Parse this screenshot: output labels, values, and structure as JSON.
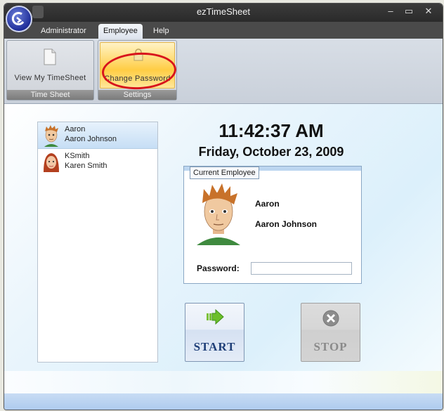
{
  "window": {
    "title": "ezTimeSheet",
    "controls": {
      "minimize": "–",
      "maximize": "▭",
      "close": "✕"
    }
  },
  "menu": {
    "tabs": [
      {
        "label": "Administrator",
        "active": false
      },
      {
        "label": "Employee",
        "active": true
      },
      {
        "label": "Help",
        "active": false
      }
    ]
  },
  "ribbon": {
    "groups": [
      {
        "label": "Time Sheet",
        "button": {
          "label": "View My TimeSheet",
          "icon": "document-icon"
        }
      },
      {
        "label": "Settings",
        "button": {
          "label": "Change Password",
          "icon": "lock-icon",
          "highlighted": true
        }
      }
    ]
  },
  "employees": [
    {
      "username": "Aaron",
      "full_name": "Aaron Johnson",
      "avatar": "male-avatar",
      "selected": true
    },
    {
      "username": "KSmith",
      "full_name": "Karen Smith",
      "avatar": "female-avatar",
      "selected": false
    }
  ],
  "clock": {
    "time": "11:42:37 AM",
    "date": "Friday, October 23, 2009"
  },
  "current_employee": {
    "legend": "Current Employee",
    "username": "Aaron",
    "full_name": "Aaron Johnson",
    "password_label": "Password:",
    "password_value": ""
  },
  "actions": {
    "start_label": "START",
    "stop_label": "STOP",
    "stop_enabled": false
  },
  "colors": {
    "annotation": "#d8141c",
    "start_text": "#1f3f78",
    "hot_button": "#ffd766"
  }
}
